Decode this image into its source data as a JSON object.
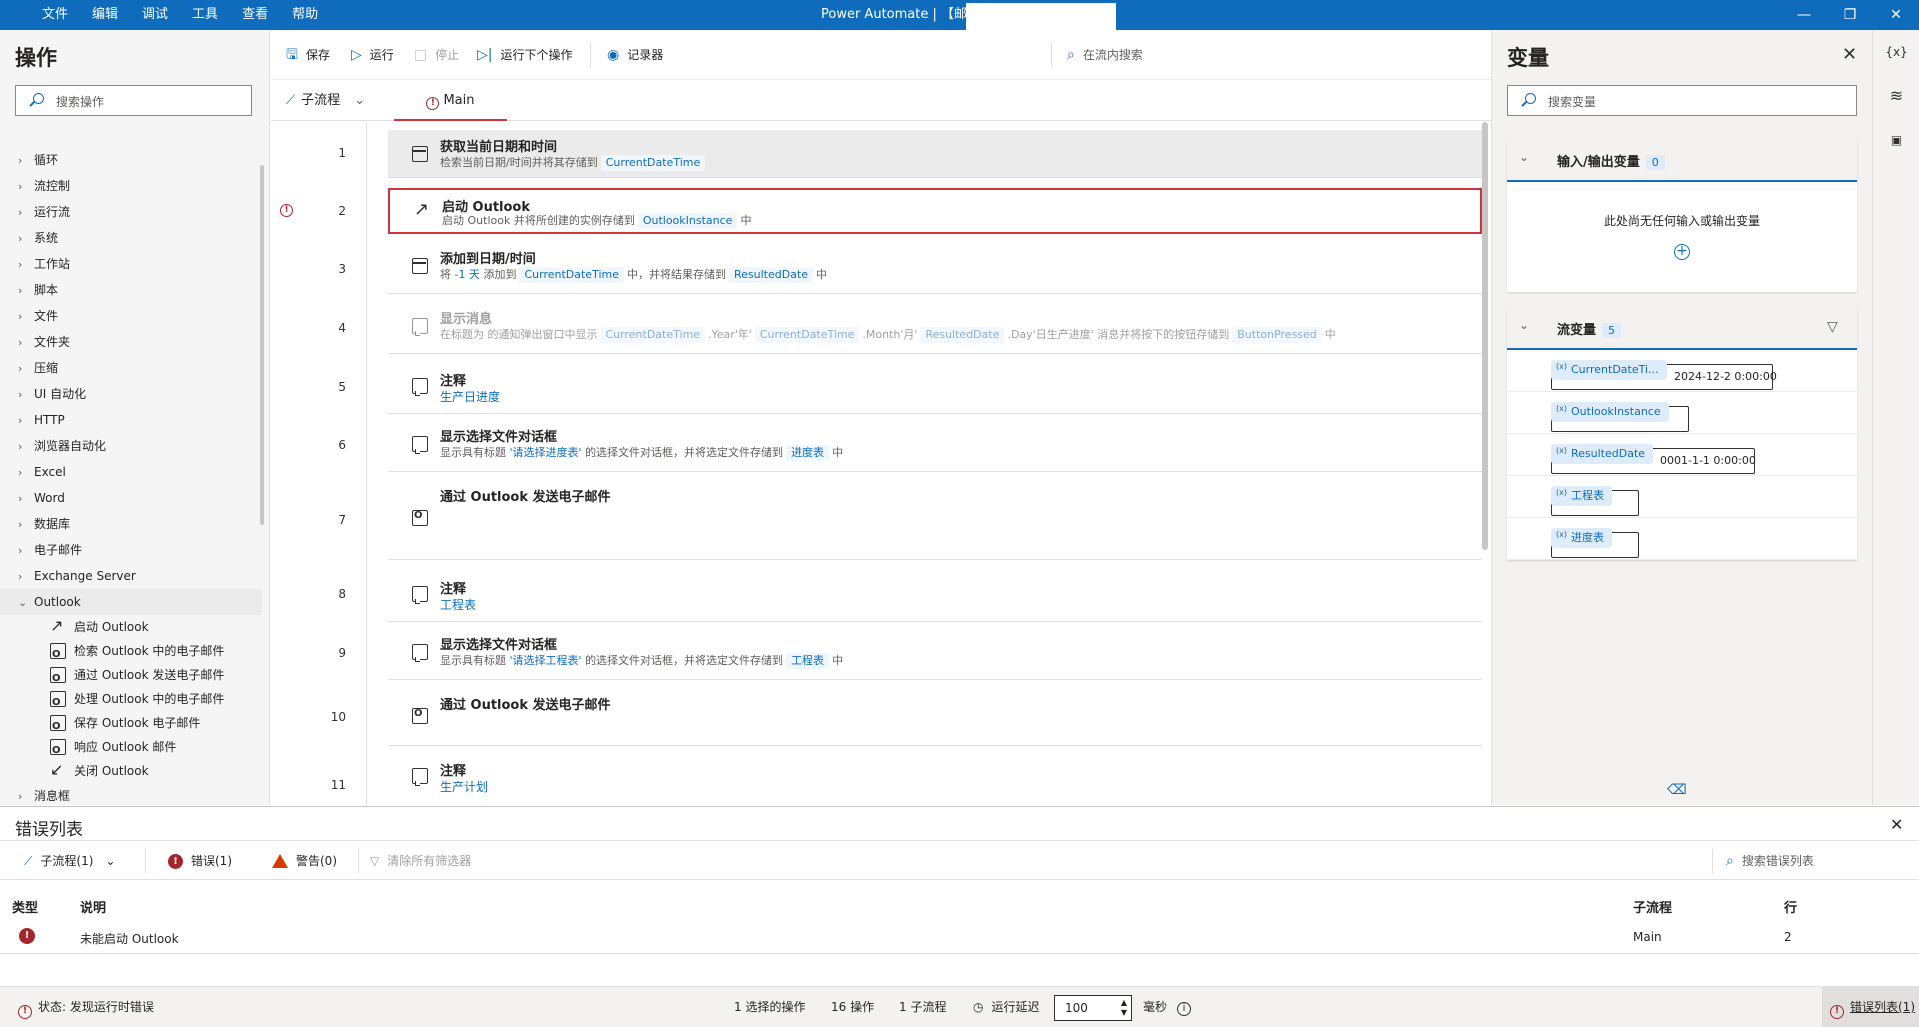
{
  "titlebar": {
    "menu": [
      "文件",
      "编辑",
      "调试",
      "工具",
      "查看",
      "帮助"
    ],
    "title": "Power Automate | 【邮件】",
    "controls": [
      "—",
      "❐",
      "✕"
    ]
  },
  "left_panel": {
    "title": "操作",
    "search_placeholder": "搜索操作",
    "categories": [
      "循环",
      "流控制",
      "运行流",
      "系统",
      "工作站",
      "脚本",
      "文件",
      "文件夹",
      "压缩",
      "UI 自动化",
      "HTTP",
      "浏览器自动化",
      "Excel",
      "Word",
      "数据库",
      "电子邮件",
      "Exchange Server",
      "Outlook"
    ],
    "outlook_actions": [
      "启动 Outlook",
      "检索 Outlook 中的电子邮件",
      "通过 Outlook 发送电子邮件",
      "处理 Outlook 中的电子邮件",
      "保存 Outlook 电子邮件",
      "响应 Outlook 邮件",
      "关闭 Outlook"
    ],
    "after": "消息框"
  },
  "toolbar": {
    "save": "保存",
    "run": "运行",
    "stop": "停止",
    "run_next": "运行下个操作",
    "recorder": "记录器",
    "search_in_flow": "在流内搜索"
  },
  "tabs": {
    "subflow": "子流程",
    "main": "Main"
  },
  "flow": [
    {
      "line": "1",
      "title": "获取当前日期和时间",
      "desc_pre": "检索当前日期/时间并将其存储到",
      "chip": "CurrentDateTime"
    },
    {
      "line": "2",
      "title": "启动 Outlook",
      "desc_pre": "启动 Outlook 并将所创建的实例存储到",
      "chip": "OutlookInstance",
      "desc_post": "中"
    },
    {
      "line": "3",
      "title": "添加到日期/时间",
      "desc_a": "将",
      "desc_b": "-1 天",
      "desc_c": "添加到",
      "chip1": "CurrentDateTime",
      "desc_d": "中，并将结果存储到",
      "chip2": "ResultedDate",
      "desc_e": "中"
    },
    {
      "line": "4",
      "title": "显示消息",
      "desc_a": "在标题为  的通知弹出窗口中显示",
      "chip1": "CurrentDateTime",
      "t1": ".Year'年'",
      "chip2": "CurrentDateTime",
      "t2": ".Month'月'",
      "chip3": "ResultedDate",
      "t3": ".Day'日生产进度'",
      "desc_b": "消息并将按下的按钮存储到",
      "chip4": "ButtonPressed",
      "desc_c": "中"
    },
    {
      "line": "5",
      "title": "注释",
      "desc": "生产日进度"
    },
    {
      "line": "6",
      "title": "显示选择文件对话框",
      "desc_a": "显示具有标题",
      "link": "'请选择进度表'",
      "desc_b": "的选择文件对话框，并将选定文件存储到",
      "chip": "进度表",
      "desc_c": "中"
    },
    {
      "line": "7",
      "title": "通过 Outlook 发送电子邮件"
    },
    {
      "line": "8",
      "title": "注释",
      "desc": "工程表"
    },
    {
      "line": "9",
      "title": "显示选择文件对话框",
      "desc_a": "显示具有标题",
      "link": "'请选择工程表'",
      "desc_b": "的选择文件对话框，并将选定文件存储到",
      "chip": "工程表",
      "desc_c": "中"
    },
    {
      "line": "10",
      "title": "通过 Outlook 发送电子邮件"
    },
    {
      "line": "11",
      "title": "注释",
      "desc": "生产计划"
    }
  ],
  "variables": {
    "title": "变量",
    "search_placeholder": "搜索变量",
    "io_title": "输入/输出变量",
    "io_count": "0",
    "io_empty": "此处尚无任何输入或输出变量",
    "flow_title": "流变量",
    "flow_count": "5",
    "items": [
      {
        "name": "CurrentDateTi...",
        "value": "2024-12-2 0:00:00"
      },
      {
        "name": "OutlookInstance",
        "value": ""
      },
      {
        "name": "ResultedDate",
        "value": "0001-1-1 0:00:00"
      },
      {
        "name": "工程表",
        "value": ""
      },
      {
        "name": "进度表",
        "value": ""
      }
    ]
  },
  "right_strip": [
    "{x}",
    "≋",
    "▣"
  ],
  "error_list": {
    "title": "错误列表",
    "subflow_filter": "子流程(1)",
    "errors": "错误(1)",
    "warnings": "警告(0)",
    "clear_filters": "清除所有筛选器",
    "search_placeholder": "搜索错误列表",
    "headers": {
      "type": "类型",
      "desc": "说明",
      "subflow": "子流程",
      "line": "行"
    },
    "rows": [
      {
        "desc": "未能启动 Outlook",
        "subflow": "Main",
        "line": "2"
      }
    ]
  },
  "status": {
    "state": "状态: 发现运行时错误",
    "selected": "1 选择的操作",
    "actions": "16 操作",
    "subflows": "1 子流程",
    "delay_label": "运行延迟",
    "delay_value": "100",
    "unit": "毫秒",
    "errlist_link": "错误列表(1)"
  },
  "colors": {
    "accent": "#0f6cbd",
    "error": "#d13438",
    "warning": "#d83b01"
  }
}
